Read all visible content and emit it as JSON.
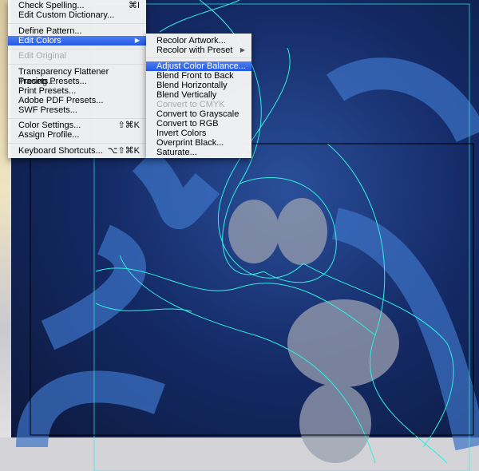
{
  "main_menu": {
    "items": [
      {
        "label": "Check Spelling...",
        "shortcut": "⌘I"
      },
      {
        "label": "Edit Custom Dictionary..."
      },
      {
        "label": "Define Pattern..."
      },
      {
        "label": "Edit Colors",
        "submenu": true,
        "highlighted": true
      },
      {
        "label": "Edit Original",
        "disabled": true
      },
      {
        "label": "Transparency Flattener Presets..."
      },
      {
        "label": "Tracing Presets..."
      },
      {
        "label": "Print Presets..."
      },
      {
        "label": "Adobe PDF Presets..."
      },
      {
        "label": "SWF Presets..."
      },
      {
        "label": "Color Settings...",
        "shortcut": "⇧⌘K"
      },
      {
        "label": "Assign Profile..."
      },
      {
        "label": "Keyboard Shortcuts...",
        "shortcut": "⌥⇧⌘K"
      }
    ]
  },
  "submenu": {
    "items": [
      {
        "label": "Recolor Artwork..."
      },
      {
        "label": "Recolor with Preset",
        "submenu": true
      },
      {
        "label": "Adjust Color Balance...",
        "highlighted": true
      },
      {
        "label": "Blend Front to Back"
      },
      {
        "label": "Blend Horizontally"
      },
      {
        "label": "Blend Vertically"
      },
      {
        "label": "Convert to CMYK",
        "disabled": true
      },
      {
        "label": "Convert to Grayscale"
      },
      {
        "label": "Convert to RGB"
      },
      {
        "label": "Invert Colors"
      },
      {
        "label": "Overprint Black..."
      },
      {
        "label": "Saturate..."
      }
    ]
  },
  "colors": {
    "highlight": "#2f62e8",
    "path": "#2ef0e0",
    "artwork_bg": "#142a66"
  }
}
